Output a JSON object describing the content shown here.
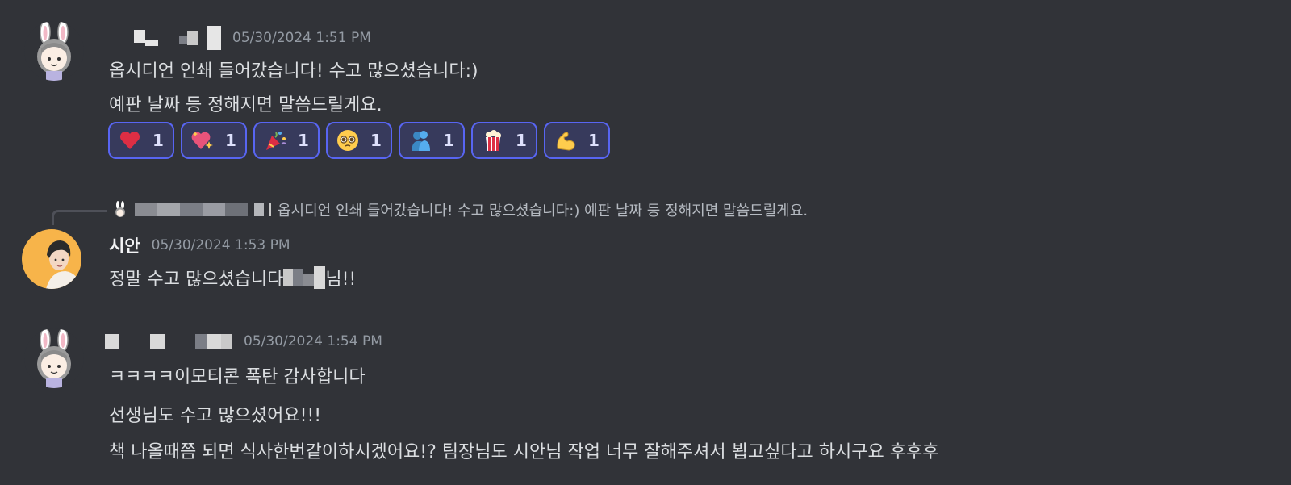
{
  "messages": [
    {
      "author": "",
      "timestamp": "05/30/2024 1:51 PM",
      "lines": [
        "옵시디언 인쇄 들어갔습니다! 수고 많으셨습니다:)",
        "예판 날짜 등 정해지면 말씀드릴게요."
      ],
      "reactions": [
        {
          "icon": "heart-icon",
          "count": "1"
        },
        {
          "icon": "sparkling-heart-icon",
          "count": "1"
        },
        {
          "icon": "party-popper-icon",
          "count": "1"
        },
        {
          "icon": "pleading-face-icon",
          "count": "1"
        },
        {
          "icon": "people-hugging-icon",
          "count": "1"
        },
        {
          "icon": "popcorn-icon",
          "count": "1"
        },
        {
          "icon": "flexed-biceps-icon",
          "count": "1"
        }
      ]
    },
    {
      "reply_to": {
        "text": "옵시디언 인쇄 들어갔습니다! 수고 많으셨습니다:) 예판 날짜 등 정해지면 말씀드릴게요."
      },
      "author": "시안",
      "timestamp": "05/30/2024 1:53 PM",
      "line_prefix": "정말 수고 많으셨습니다",
      "line_suffix": "님!!"
    },
    {
      "author": "",
      "timestamp": "05/30/2024 1:54 PM",
      "lines": [
        "ㅋㅋㅋㅋ이모티콘 폭탄 감사합니다",
        "선생님도 수고 많으셨어요!!!",
        "책 나올때쯤 되면 식사한번같이하시겠어요!? 팀장님도 시안님 작업 너무 잘해주셔서 뵙고싶다고 하시구요 후후후"
      ]
    }
  ],
  "colors": {
    "background": "#313338",
    "reaction_border": "#5865f2",
    "reaction_bg": "#373a5c"
  }
}
